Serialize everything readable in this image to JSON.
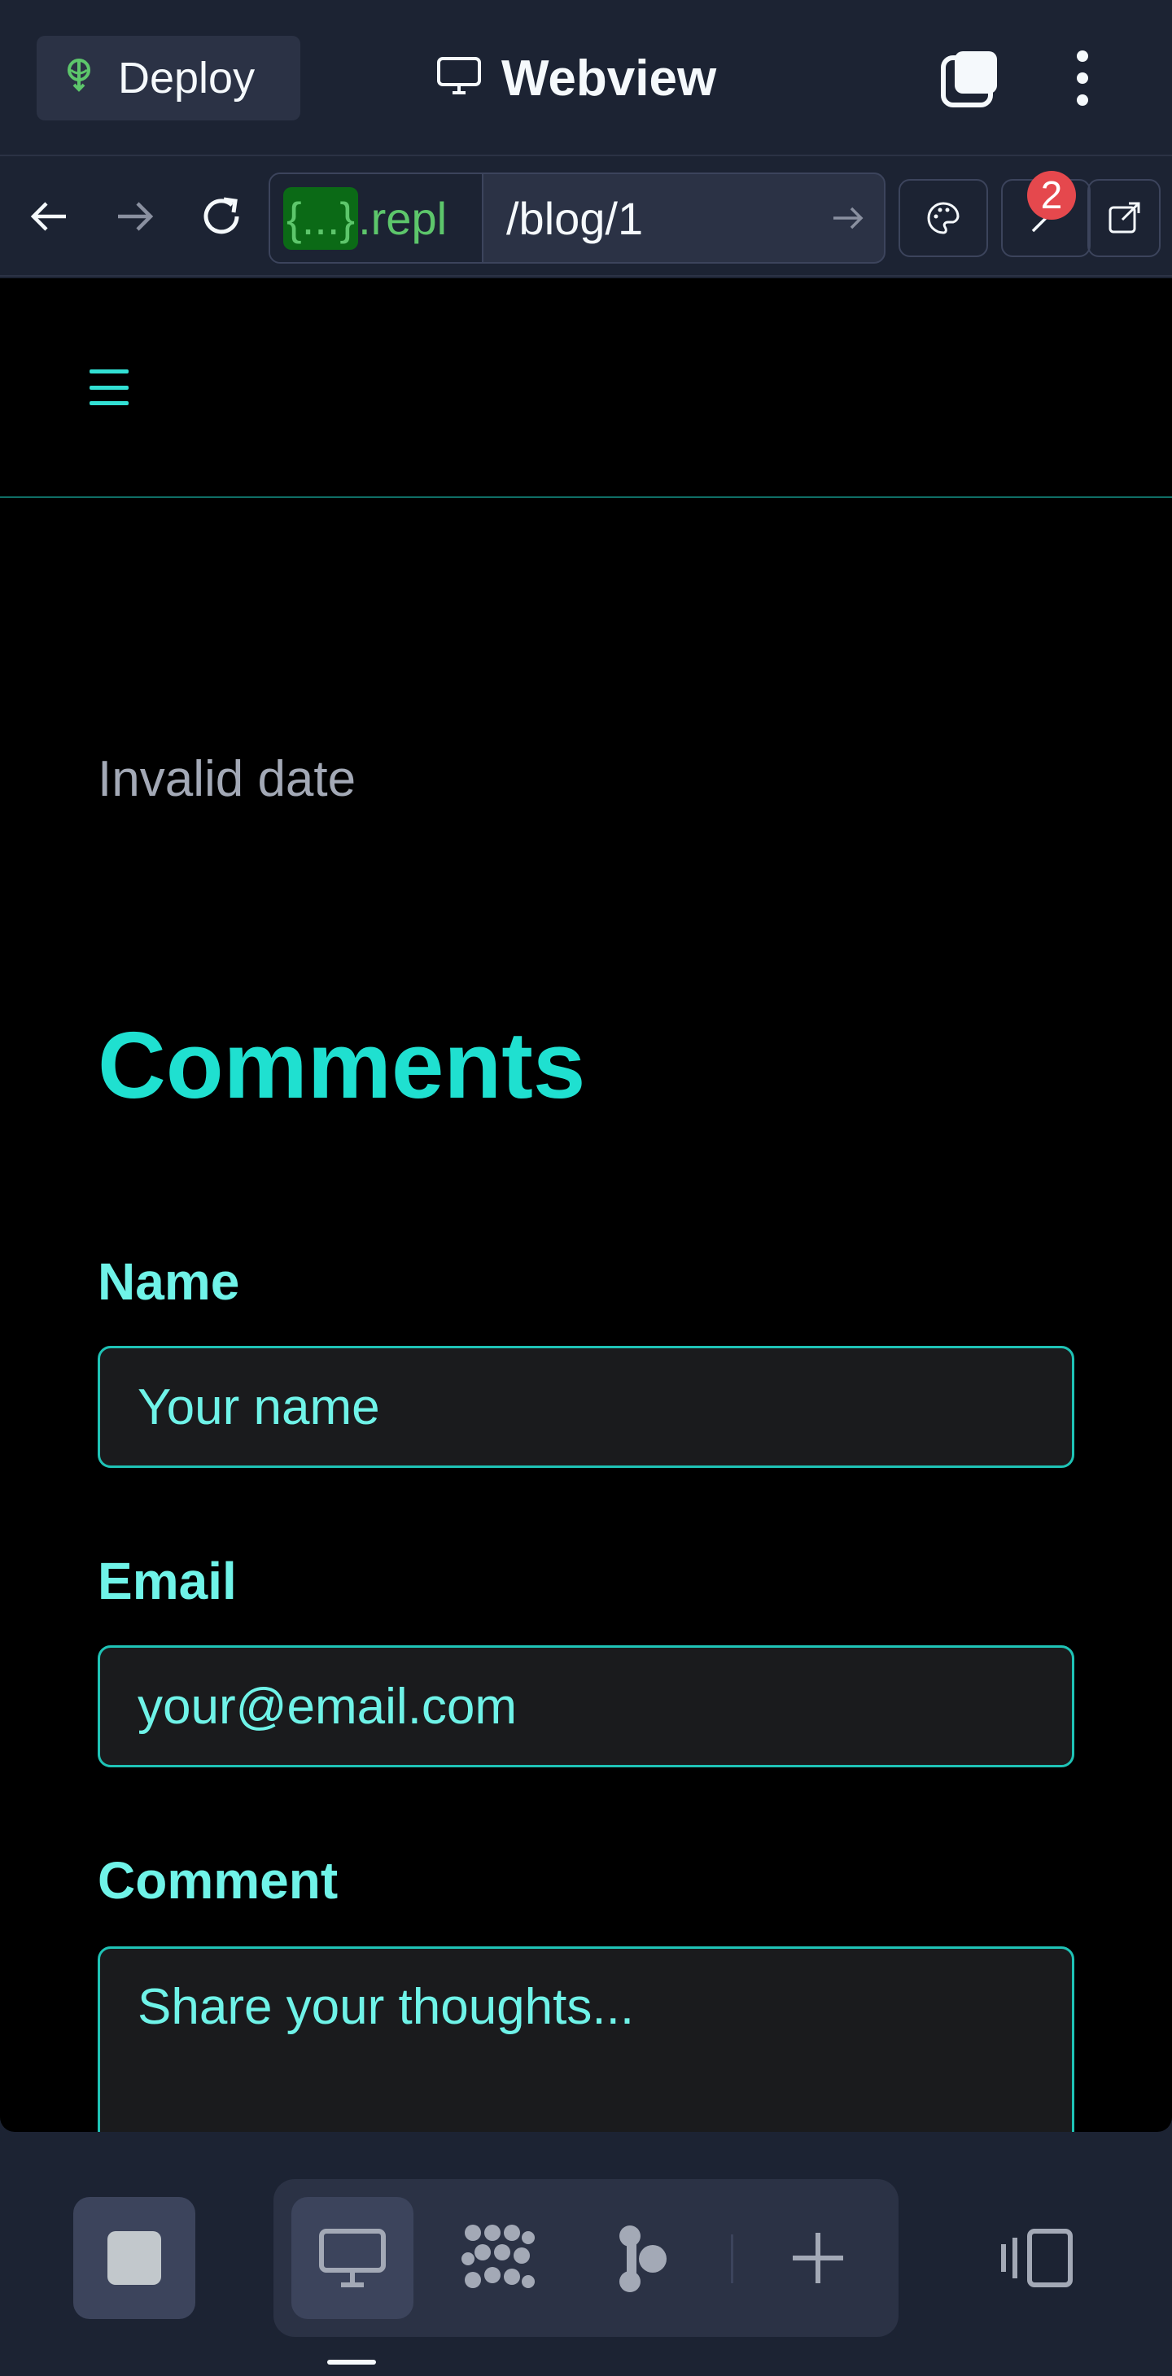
{
  "top_bar": {
    "deploy_label": "Deploy",
    "tab_title": "Webview"
  },
  "url_bar": {
    "host_token": "{...}",
    "host_suffix": ".repl",
    "path": "/blog/1",
    "devtools_badge": "2"
  },
  "page": {
    "date": "Invalid date",
    "comments_heading": "Comments",
    "form": {
      "name_label": "Name",
      "name_placeholder": "Your name",
      "email_label": "Email",
      "email_placeholder": "your@email.com",
      "comment_label": "Comment",
      "comment_placeholder": "Share your thoughts..."
    }
  },
  "colors": {
    "accent": "#1fe0d0",
    "accent_light": "#6ff3e8",
    "chrome_bg": "#1c2333",
    "deploy_green": "#5dc66b",
    "badge_red": "#e5484d"
  },
  "icons": {
    "deploy": "deploy-icon",
    "tab": "monitor-icon",
    "tabs_switcher": "tabs-icon",
    "more": "more-vertical-icon",
    "back": "arrow-left-icon",
    "forward": "arrow-right-icon",
    "reload": "reload-icon",
    "theme": "palette-icon",
    "devtools": "wrench-icon",
    "external": "external-link-icon",
    "menu": "hamburger-icon",
    "stop": "stop-icon",
    "webview": "monitor-icon",
    "agent": "agent-icon",
    "workflow": "workflow-icon",
    "add": "plus-icon",
    "panel": "panel-toggle-icon"
  }
}
